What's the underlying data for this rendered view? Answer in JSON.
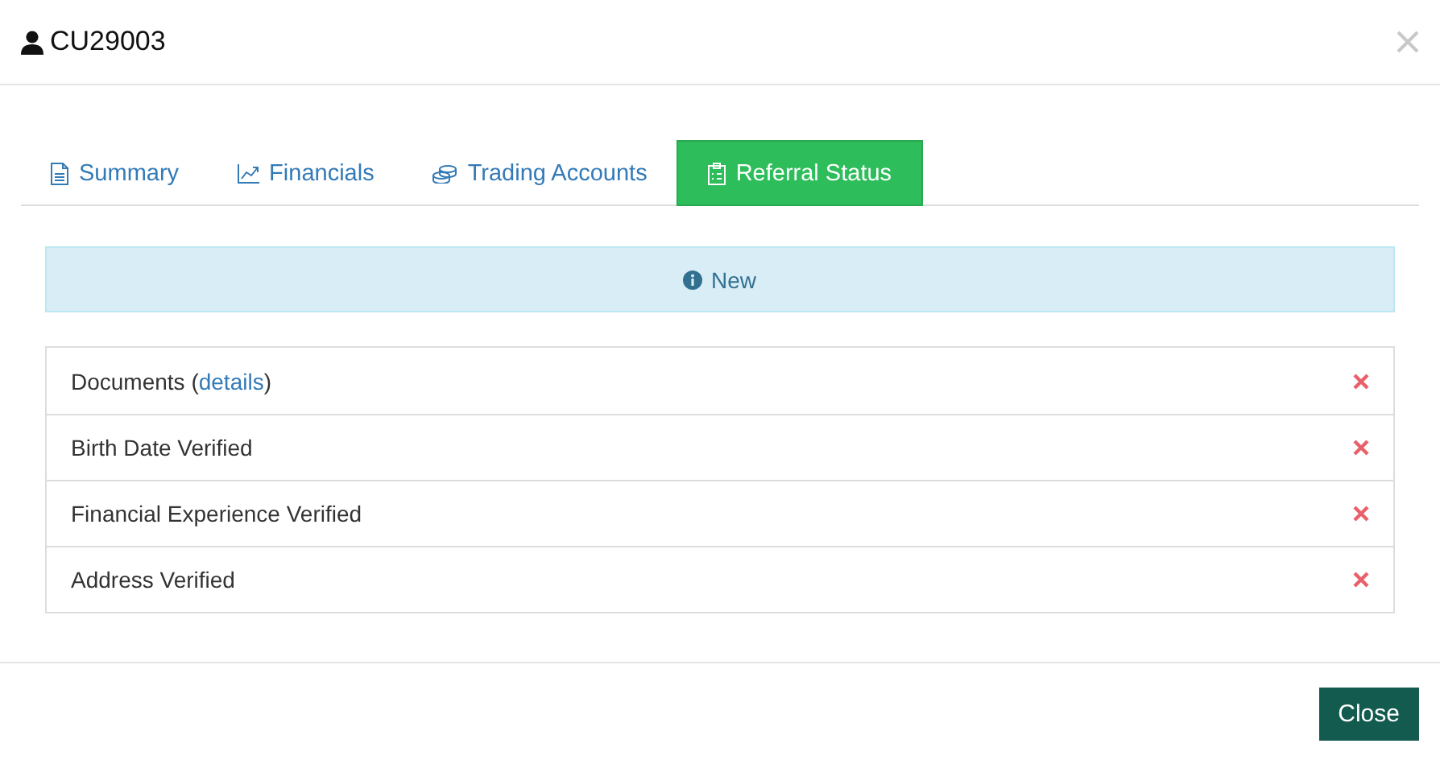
{
  "window": {
    "title": "CU29003"
  },
  "tabs": [
    {
      "label": "Summary",
      "selected": false
    },
    {
      "label": "Financials",
      "selected": false
    },
    {
      "label": "Trading Accounts",
      "selected": false
    },
    {
      "label": "Referral Status",
      "selected": true
    }
  ],
  "status_alert": {
    "text": "New"
  },
  "checks": [
    {
      "prefix": "Documents (",
      "link": "details",
      "suffix": ")",
      "verified": false
    },
    {
      "prefix": "Birth Date Verified",
      "verified": false
    },
    {
      "prefix": "Financial Experience Verified",
      "verified": false
    },
    {
      "prefix": "Address Verified",
      "verified": false
    }
  ],
  "buttons": [
    {
      "label": "Close"
    }
  ]
}
